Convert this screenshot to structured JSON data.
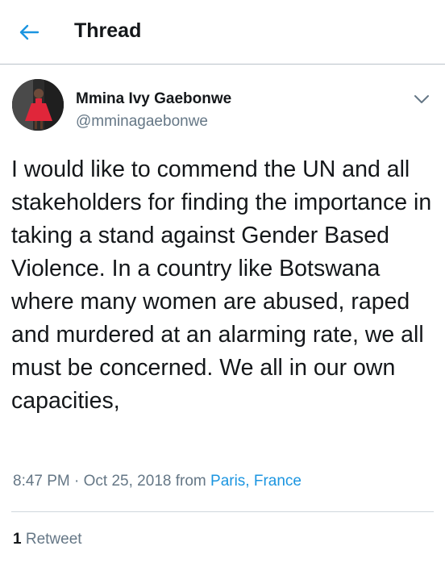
{
  "header": {
    "title": "Thread",
    "back_icon": "arrow-left-icon",
    "accent": "#1b95e0"
  },
  "tweet": {
    "author": {
      "name": "Mmina Ivy Gaebonwe",
      "handle": "@mminagaebonwe"
    },
    "menu_icon": "chevron-down-icon",
    "text": "I would like to commend the UN and all stakeholders for finding the importance in taking a stand against Gender Based Violence. In a country like Botswana where many women are abused, raped and murdered at an alarming rate, we all must be concerned. We all in our own capacities,",
    "time": "8:47 PM",
    "separator": "·",
    "date": "Oct 25, 2018",
    "from_label": "from",
    "place": "Paris, France",
    "retweet_count": "1",
    "retweet_label": "Retweet"
  }
}
